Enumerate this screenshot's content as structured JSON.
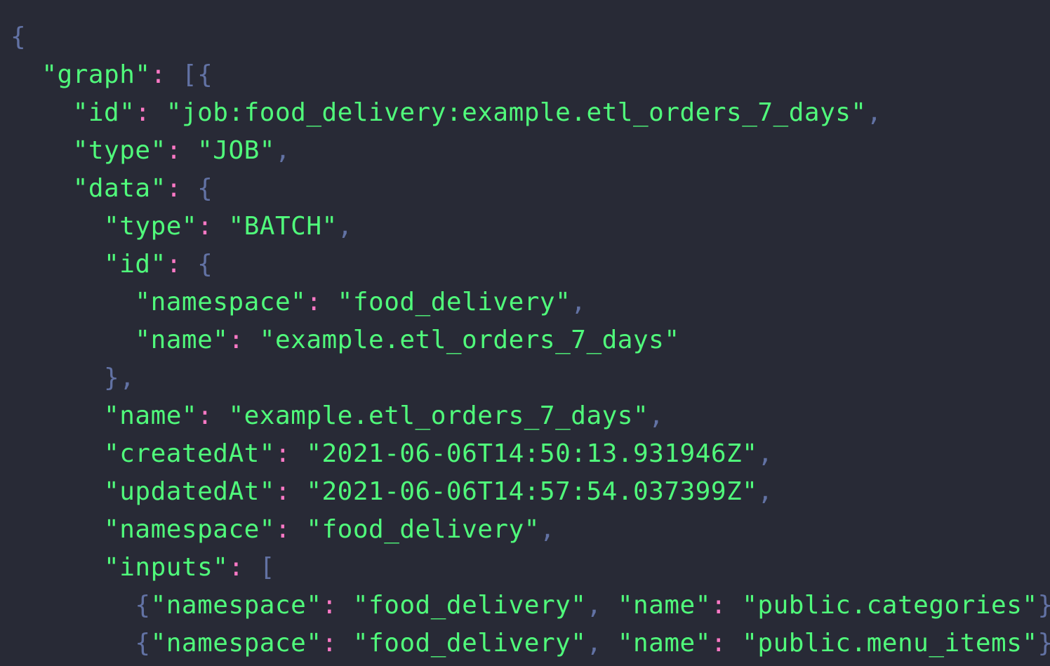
{
  "lines": [
    {
      "indent": 0,
      "tokens": [
        {
          "t": "p",
          "v": "{"
        }
      ]
    },
    {
      "indent": 1,
      "tokens": [
        {
          "t": "k",
          "v": "\"graph\""
        },
        {
          "t": "c",
          "v": ": "
        },
        {
          "t": "p",
          "v": "[{"
        }
      ]
    },
    {
      "indent": 2,
      "tokens": [
        {
          "t": "k",
          "v": "\"id\""
        },
        {
          "t": "c",
          "v": ": "
        },
        {
          "t": "s",
          "v": "\"job:food_delivery:example.etl_orders_7_days\""
        },
        {
          "t": "p",
          "v": ","
        }
      ]
    },
    {
      "indent": 2,
      "tokens": [
        {
          "t": "k",
          "v": "\"type\""
        },
        {
          "t": "c",
          "v": ": "
        },
        {
          "t": "s",
          "v": "\"JOB\""
        },
        {
          "t": "p",
          "v": ","
        }
      ]
    },
    {
      "indent": 2,
      "tokens": [
        {
          "t": "k",
          "v": "\"data\""
        },
        {
          "t": "c",
          "v": ": "
        },
        {
          "t": "p",
          "v": "{"
        }
      ]
    },
    {
      "indent": 3,
      "tokens": [
        {
          "t": "k",
          "v": "\"type\""
        },
        {
          "t": "c",
          "v": ": "
        },
        {
          "t": "s",
          "v": "\"BATCH\""
        },
        {
          "t": "p",
          "v": ","
        }
      ]
    },
    {
      "indent": 3,
      "tokens": [
        {
          "t": "k",
          "v": "\"id\""
        },
        {
          "t": "c",
          "v": ": "
        },
        {
          "t": "p",
          "v": "{"
        }
      ]
    },
    {
      "indent": 4,
      "tokens": [
        {
          "t": "k",
          "v": "\"namespace\""
        },
        {
          "t": "c",
          "v": ": "
        },
        {
          "t": "s",
          "v": "\"food_delivery\""
        },
        {
          "t": "p",
          "v": ","
        }
      ]
    },
    {
      "indent": 4,
      "tokens": [
        {
          "t": "k",
          "v": "\"name\""
        },
        {
          "t": "c",
          "v": ": "
        },
        {
          "t": "s",
          "v": "\"example.etl_orders_7_days\""
        }
      ]
    },
    {
      "indent": 3,
      "tokens": [
        {
          "t": "p",
          "v": "},"
        }
      ]
    },
    {
      "indent": 3,
      "tokens": [
        {
          "t": "k",
          "v": "\"name\""
        },
        {
          "t": "c",
          "v": ": "
        },
        {
          "t": "s",
          "v": "\"example.etl_orders_7_days\""
        },
        {
          "t": "p",
          "v": ","
        }
      ]
    },
    {
      "indent": 3,
      "tokens": [
        {
          "t": "k",
          "v": "\"createdAt\""
        },
        {
          "t": "c",
          "v": ": "
        },
        {
          "t": "s",
          "v": "\"2021-06-06T14:50:13.931946Z\""
        },
        {
          "t": "p",
          "v": ","
        }
      ]
    },
    {
      "indent": 3,
      "tokens": [
        {
          "t": "k",
          "v": "\"updatedAt\""
        },
        {
          "t": "c",
          "v": ": "
        },
        {
          "t": "s",
          "v": "\"2021-06-06T14:57:54.037399Z\""
        },
        {
          "t": "p",
          "v": ","
        }
      ]
    },
    {
      "indent": 3,
      "tokens": [
        {
          "t": "k",
          "v": "\"namespace\""
        },
        {
          "t": "c",
          "v": ": "
        },
        {
          "t": "s",
          "v": "\"food_delivery\""
        },
        {
          "t": "p",
          "v": ","
        }
      ]
    },
    {
      "indent": 3,
      "tokens": [
        {
          "t": "k",
          "v": "\"inputs\""
        },
        {
          "t": "c",
          "v": ": "
        },
        {
          "t": "p",
          "v": "["
        }
      ]
    },
    {
      "indent": 4,
      "tokens": [
        {
          "t": "p",
          "v": "{"
        },
        {
          "t": "k",
          "v": "\"namespace\""
        },
        {
          "t": "c",
          "v": ": "
        },
        {
          "t": "s",
          "v": "\"food_delivery\""
        },
        {
          "t": "p",
          "v": ", "
        },
        {
          "t": "k",
          "v": "\"name\""
        },
        {
          "t": "c",
          "v": ": "
        },
        {
          "t": "s",
          "v": "\"public.categories\""
        },
        {
          "t": "p",
          "v": "},"
        }
      ]
    },
    {
      "indent": 4,
      "tokens": [
        {
          "t": "p",
          "v": "{"
        },
        {
          "t": "k",
          "v": "\"namespace\""
        },
        {
          "t": "c",
          "v": ": "
        },
        {
          "t": "s",
          "v": "\"food_delivery\""
        },
        {
          "t": "p",
          "v": ", "
        },
        {
          "t": "k",
          "v": "\"name\""
        },
        {
          "t": "c",
          "v": ": "
        },
        {
          "t": "s",
          "v": "\"public.menu_items\""
        },
        {
          "t": "p",
          "v": "},"
        }
      ]
    }
  ]
}
